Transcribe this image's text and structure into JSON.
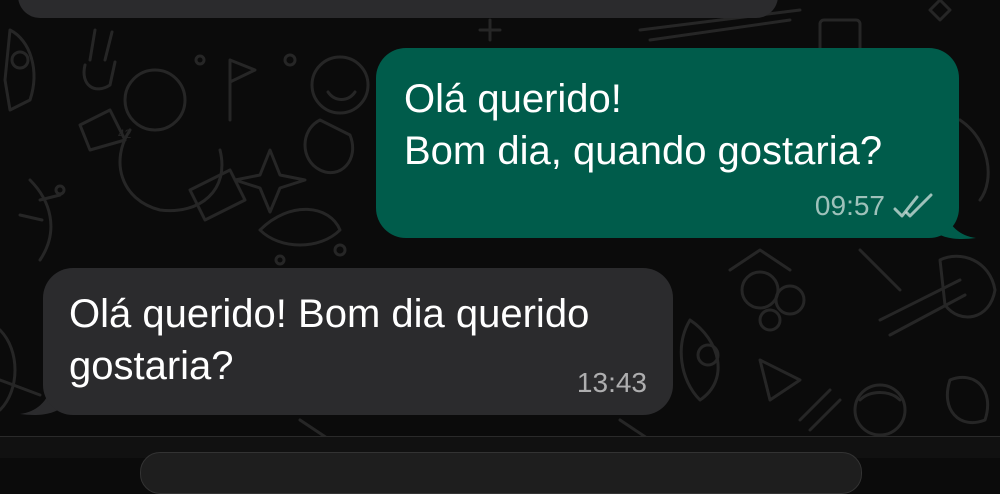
{
  "conversation": {
    "outgoing_message": {
      "line1": "Olá querido!",
      "line2": "Bom dia, quando gostaria?",
      "time": "09:57",
      "status_icon": "double-check-icon",
      "bubble_color": "#005c4b"
    },
    "incoming_message": {
      "line1": "Olá querido! Bom dia querido",
      "line2": "gostaria?",
      "time": "13:43",
      "bubble_color": "#2b2b2d"
    }
  },
  "theme": {
    "background": "#0b0b0b",
    "text_color": "#ffffff",
    "meta_color": "#9e9e9e"
  }
}
